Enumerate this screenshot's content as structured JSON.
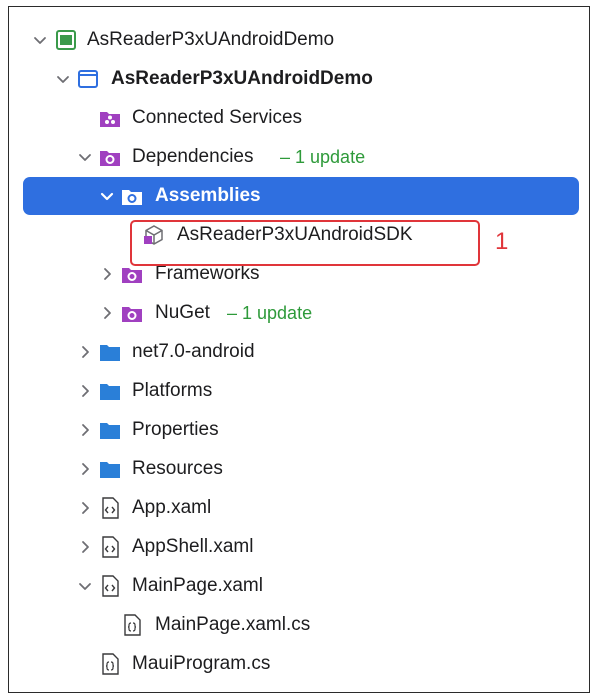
{
  "tree": {
    "solution": {
      "label": "AsReaderP3xUAndroidDemo",
      "icon": "solution-icon"
    },
    "project": {
      "label": "AsReaderP3xUAndroidDemo",
      "icon": "project-icon"
    },
    "connected_services": {
      "label": "Connected Services",
      "icon": "connected-services-icon"
    },
    "dependencies": {
      "label": "Dependencies",
      "update": "– 1 update",
      "icon": "dependencies-icon"
    },
    "assemblies": {
      "label": "Assemblies",
      "icon": "assemblies-icon"
    },
    "assembly_sdk": {
      "label": "AsReaderP3xUAndroidSDK",
      "icon": "assembly-reference-icon"
    },
    "frameworks": {
      "label": "Frameworks",
      "icon": "frameworks-icon"
    },
    "nuget": {
      "label": "NuGet",
      "update": "– 1 update",
      "icon": "nuget-icon"
    },
    "net7_android": {
      "label": "net7.0-android",
      "icon": "folder-icon"
    },
    "platforms": {
      "label": "Platforms",
      "icon": "folder-icon"
    },
    "properties": {
      "label": "Properties",
      "icon": "folder-icon"
    },
    "resources": {
      "label": "Resources",
      "icon": "folder-icon"
    },
    "app_xaml": {
      "label": "App.xaml",
      "icon": "xaml-file-icon"
    },
    "appshell_xaml": {
      "label": "AppShell.xaml",
      "icon": "xaml-file-icon"
    },
    "mainpage_xaml": {
      "label": "MainPage.xaml",
      "icon": "xaml-file-icon"
    },
    "mainpage_cs": {
      "label": "MainPage.xaml.cs",
      "icon": "csharp-file-icon"
    },
    "mauiprogram_cs": {
      "label": "MauiProgram.cs",
      "icon": "csharp-file-icon"
    }
  },
  "annotation": {
    "callout": "1"
  },
  "colors": {
    "selection": "#2f6fe0",
    "update_text": "#2e9a3a",
    "highlight_border": "#e0353a",
    "folder_blue": "#2a7fd8",
    "purple": "#a040c0"
  }
}
